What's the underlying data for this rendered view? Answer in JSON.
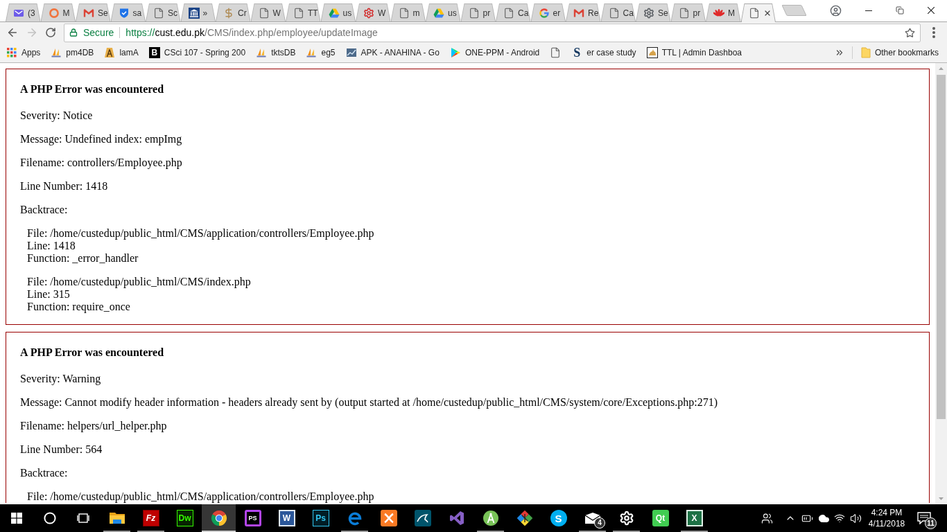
{
  "tabs": [
    {
      "kind": "mail",
      "title": "(3",
      "selected": false
    },
    {
      "kind": "ring",
      "title": "M",
      "selected": false
    },
    {
      "kind": "gmail",
      "title": "Se",
      "selected": false
    },
    {
      "kind": "shield",
      "title": "sa",
      "selected": false
    },
    {
      "kind": "page",
      "title": "Sc",
      "selected": false
    },
    {
      "kind": "bank",
      "title": "»",
      "selected": false
    },
    {
      "kind": "dollar",
      "title": "Cr",
      "selected": false
    },
    {
      "kind": "page",
      "title": "W",
      "selected": false
    },
    {
      "kind": "page",
      "title": "TT",
      "selected": false
    },
    {
      "kind": "drive",
      "title": "us",
      "selected": false
    },
    {
      "kind": "gears",
      "title": "W",
      "selected": false
    },
    {
      "kind": "page",
      "title": "m",
      "selected": false
    },
    {
      "kind": "drive",
      "title": "us",
      "selected": false
    },
    {
      "kind": "page",
      "title": "pr",
      "selected": false
    },
    {
      "kind": "page",
      "title": "Ca",
      "selected": false
    },
    {
      "kind": "google",
      "title": "er",
      "selected": false
    },
    {
      "kind": "gmail",
      "title": "Re",
      "selected": false
    },
    {
      "kind": "page",
      "title": "Ca",
      "selected": false
    },
    {
      "kind": "gear",
      "title": "Se",
      "selected": false
    },
    {
      "kind": "page",
      "title": "pr",
      "selected": false
    },
    {
      "kind": "flower",
      "title": "M",
      "selected": false
    },
    {
      "kind": "page",
      "selected": true
    }
  ],
  "address": {
    "security_label": "Secure",
    "url_scheme": "https://",
    "url_host": "cust.edu.pk",
    "url_path": "/CMS/index.php/employee/updateImage"
  },
  "bookmarks": [
    {
      "kind": "apps",
      "label": "Apps"
    },
    {
      "kind": "pma",
      "label": "pm4DB"
    },
    {
      "kind": "lamp",
      "label": "lamA"
    },
    {
      "kind": "letter",
      "logo_text": "B",
      "label": "CSci 107 - Spring 200"
    },
    {
      "kind": "pma",
      "label": "tktsDB"
    },
    {
      "kind": "pma",
      "label": "eg5"
    },
    {
      "kind": "chart",
      "label": "APK - ANAHINA - Go"
    },
    {
      "kind": "play",
      "label": "ONE-PPM - Android"
    },
    {
      "kind": "page"
    },
    {
      "kind": "s-logo",
      "logo_text": "S",
      "label": "er case study"
    },
    {
      "kind": "cat",
      "label": "TTL | Admin Dashboa"
    }
  ],
  "other_bookmarks": {
    "label": "Other bookmarks"
  },
  "errors": [
    {
      "title": "A PHP Error was encountered",
      "details": [
        "Severity: Notice",
        "Message: Undefined index: empImg",
        "Filename: controllers/Employee.php",
        "Line Number: 1418"
      ],
      "backtrace_label": "Backtrace:",
      "backtrace": [
        {
          "file": "File: /home/custedup/public_html/CMS/application/controllers/Employee.php",
          "line": "Line: 1418",
          "function": "Function: _error_handler"
        },
        {
          "file": "File: /home/custedup/public_html/CMS/index.php",
          "line": "Line: 315",
          "function": "Function: require_once"
        }
      ]
    },
    {
      "title": "A PHP Error was encountered",
      "details": [
        "Severity: Warning",
        "Message: Cannot modify header information - headers already sent by (output started at /home/custedup/public_html/CMS/system/core/Exceptions.php:271)",
        "Filename: helpers/url_helper.php",
        "Line Number: 564"
      ],
      "backtrace_label": "Backtrace:",
      "backtrace": [
        {
          "file": "File: /home/custedup/public_html/CMS/application/controllers/Employee.php"
        }
      ]
    }
  ],
  "taskbar": {
    "apps": [
      {
        "kind": "explorer",
        "running": true,
        "selected": false
      },
      {
        "kind": "filezilla",
        "logo_text": "Fz",
        "running": true,
        "selected": false
      },
      {
        "kind": "dreamweaver",
        "logo_text": "Dw",
        "running": false,
        "selected": false
      },
      {
        "kind": "chrome",
        "running": true,
        "selected": true
      },
      {
        "kind": "phpstorm",
        "logo_text": "PS",
        "running": false,
        "selected": false
      },
      {
        "kind": "word",
        "logo_text": "W",
        "running": false,
        "selected": false
      },
      {
        "kind": "photoshop",
        "logo_text": "Ps",
        "running": false,
        "selected": false
      },
      {
        "kind": "edge",
        "running": true,
        "selected": false
      },
      {
        "kind": "xampp",
        "running": false,
        "selected": false
      },
      {
        "kind": "workbench",
        "running": false,
        "selected": false
      },
      {
        "kind": "visual-studio",
        "running": false,
        "selected": false
      },
      {
        "kind": "android-studio",
        "running": true,
        "selected": false
      },
      {
        "kind": "git",
        "running": false,
        "selected": false
      },
      {
        "kind": "skype",
        "logo_text": "S",
        "running": false,
        "selected": false
      },
      {
        "kind": "mail",
        "badge": "4",
        "running": true,
        "selected": false
      },
      {
        "kind": "settings",
        "running": true,
        "selected": false
      },
      {
        "kind": "qt",
        "logo_text": "Qt",
        "running": false,
        "selected": false
      },
      {
        "kind": "excel",
        "logo_text": "X",
        "running": true,
        "selected": false
      }
    ],
    "clock_time": "4:24 PM",
    "clock_date": "4/11/2018",
    "notification_count": "11"
  }
}
